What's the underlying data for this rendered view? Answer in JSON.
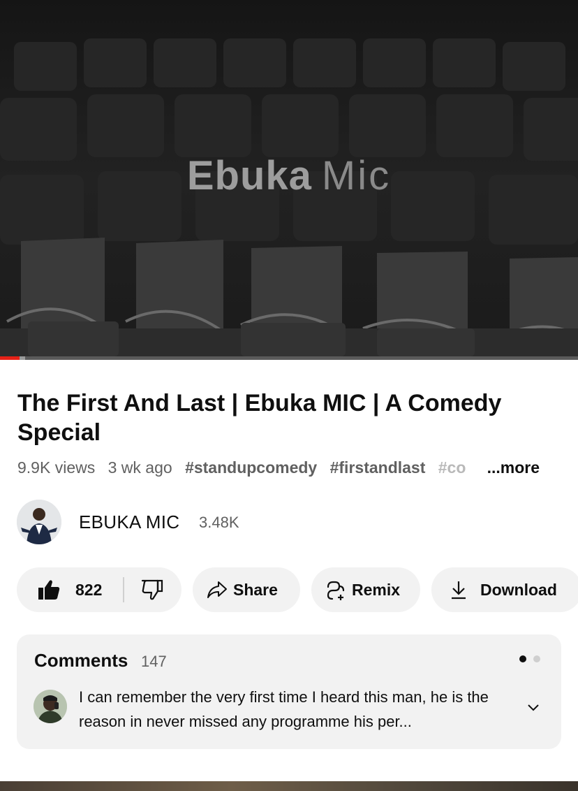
{
  "player": {
    "overlay_bold": "Ebuka",
    "overlay_light": "Mic",
    "progress_fraction": 0.034,
    "buffered_fraction": 0.044
  },
  "video": {
    "title": "The First And Last | Ebuka MIC | A Comedy Special",
    "views": "9.9K views",
    "age": "3 wk ago",
    "tags": [
      "#standupcomedy",
      "#firstandlast"
    ],
    "tag_truncated": "#co",
    "more_label": "...more"
  },
  "channel": {
    "name": "EBUKA MIC",
    "subscribers": "3.48K"
  },
  "actions": {
    "like_count": "822",
    "share_label": "Share",
    "remix_label": "Remix",
    "download_label": "Download"
  },
  "comments": {
    "heading": "Comments",
    "count": "147",
    "top_comment": "I can remember the very first time I heard this man, he is the reason in never missed any programme his per...",
    "pager_active_index": 0,
    "pager_total": 2
  },
  "icons": {
    "like": "thumbs-up-icon",
    "dislike": "thumbs-down-icon",
    "share": "share-arrow-icon",
    "remix": "remix-icon",
    "download": "download-icon",
    "expand": "chevron-down-icon"
  },
  "colors": {
    "progress": "#e62117",
    "pill_bg": "#f2f2f2",
    "text_primary": "#0f0f0f",
    "text_secondary": "#606060"
  }
}
